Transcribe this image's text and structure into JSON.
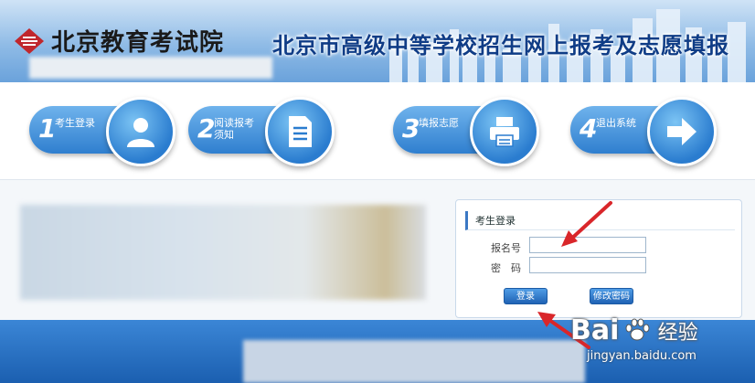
{
  "header": {
    "org_name": "北京教育考试院",
    "site_title": "北京市高级中等学校招生网上报考及志愿填报"
  },
  "steps": [
    {
      "num": "1",
      "label": "考生登录",
      "icon": "user-icon"
    },
    {
      "num": "2",
      "label": "阅读报考须知",
      "icon": "document-icon"
    },
    {
      "num": "3",
      "label": "填报志愿",
      "icon": "printer-icon"
    },
    {
      "num": "4",
      "label": "退出系统",
      "icon": "arrow-right-icon"
    }
  ],
  "login": {
    "title": "考生登录",
    "username_label": "报名号",
    "password_label": "密　码",
    "username_value": "",
    "password_value": "",
    "submit_label": "登录",
    "change_password_label": "修改密码"
  },
  "watermark": {
    "brand": "Bai",
    "brand_cn": "经验",
    "url": "jingyan.baidu.com"
  },
  "colors": {
    "accent": "#2a7ccf",
    "title_blue": "#0f3c86",
    "arrow_red": "#d9262a"
  }
}
